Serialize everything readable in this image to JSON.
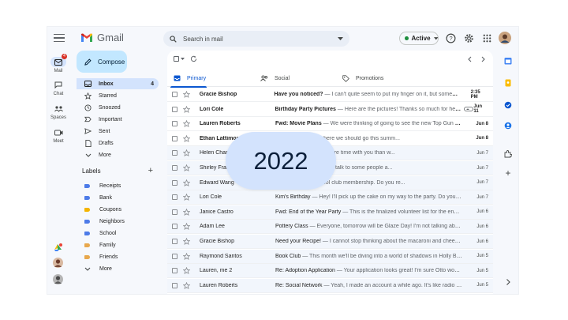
{
  "header": {
    "app_name": "Gmail",
    "search_placeholder": "Search in mail",
    "status": "Active"
  },
  "rail": [
    {
      "label": "Mail",
      "badge": "4"
    },
    {
      "label": "Chat"
    },
    {
      "label": "Spaces"
    },
    {
      "label": "Meet"
    }
  ],
  "compose_label": "Compose",
  "folders": [
    {
      "label": "Inbox",
      "count": "4"
    },
    {
      "label": "Starred"
    },
    {
      "label": "Snoozed"
    },
    {
      "label": "Important"
    },
    {
      "label": "Sent"
    },
    {
      "label": "Drafts"
    },
    {
      "label": "More"
    }
  ],
  "labels_heading": "Labels",
  "labels": [
    {
      "name": "Receipts",
      "color": "#4d7be8"
    },
    {
      "name": "Bank",
      "color": "#4d7be8"
    },
    {
      "name": "Coupons",
      "color": "#f4b400"
    },
    {
      "name": "Neighbors",
      "color": "#4d7be8"
    },
    {
      "name": "School",
      "color": "#4d7be8"
    },
    {
      "name": "Family",
      "color": "#e8a84d"
    },
    {
      "name": "Friends",
      "color": "#e8a84d"
    }
  ],
  "labels_more": "More",
  "tabs": [
    {
      "label": "Primary"
    },
    {
      "label": "Social"
    },
    {
      "label": "Promotions"
    }
  ],
  "emails": [
    {
      "sender": "Gracie Bishop",
      "subject": "Have you noticed?",
      "snippet": " — I can't quite seem to put my finger on it, but something...",
      "date": "2:35 PM",
      "unread": true
    },
    {
      "sender": "Lori Cole",
      "subject": "Birthday Party Pictures",
      "snippet": " — Here are the pictures! Thanks so much for helpi...",
      "date": "Jun 11",
      "unread": true,
      "attachment": true
    },
    {
      "sender": "Lauren Roberts",
      "subject": "Fwd: Movie Plans",
      "snippet": " — We were thinking of going to see the new Top Gun mo...",
      "date": "Jun 8",
      "unread": true
    },
    {
      "sender": "Ethan Lattimore",
      "subject": "",
      "snippet": "we through about where we should go this summ...",
      "date": "Jun 8",
      "unread": true
    },
    {
      "sender": "Helen Chang",
      "subject": "",
      "snippet": "nt, my hat has spent more time with you than w...",
      "date": "Jun 7",
      "unread": false
    },
    {
      "sender": "Shirley Franklin",
      "subject": "",
      "snippet": "realize that. I'm going to talk to some people a...",
      "date": "Jun 7",
      "unread": false
    },
    {
      "sender": "Edward Wang",
      "subject": "",
      "snippet": "time to renew our pool club membership. Do you re...",
      "date": "Jun 7",
      "unread": false
    },
    {
      "sender": "Lori Cole",
      "subject": "Kim's Birthday",
      "snippet": " — Hey! I'll pick up the cake on my way to the party. Do you th...",
      "date": "Jun 7",
      "unread": false
    },
    {
      "sender": "Janice Castro",
      "subject": "Fwd: End of the Year Party",
      "snippet": " — This is the finalized volunteer list for the end of...",
      "date": "Jun 6",
      "unread": false
    },
    {
      "sender": "Adam Lee",
      "subject": "Pottery Class",
      "snippet": " — Everyone, tomorrow will be Glaze Day! I'm not talking about...",
      "date": "Jun 6",
      "unread": false
    },
    {
      "sender": "Gracie Bishop",
      "subject": "Need your Recipe!",
      "snippet": " — I cannot stop thinking about the macaroni and cheese...",
      "date": "Jun 6",
      "unread": false
    },
    {
      "sender": "Raymond Santos",
      "subject": "Book Club",
      "snippet": " — This month we'll be diving into a world of shadows in Holly Bla...",
      "date": "Jun 5",
      "unread": false
    },
    {
      "sender": "Lauren, me  2",
      "subject": "Re: Adoption Application",
      "snippet": " — Your application looks great! I'm sure Otto would...",
      "date": "Jun 5",
      "unread": false
    },
    {
      "sender": "Lauren Roberts",
      "subject": "Re: Social Network",
      "snippet": " — Yeah, I made an account a while ago. It's like radio but...",
      "date": "Jun 5",
      "unread": false
    }
  ],
  "overlay": {
    "year": "2022"
  },
  "colors": {
    "accent": "#0b57d0",
    "compose": "#c2e7ff",
    "active_bg": "#d3e3fd"
  }
}
